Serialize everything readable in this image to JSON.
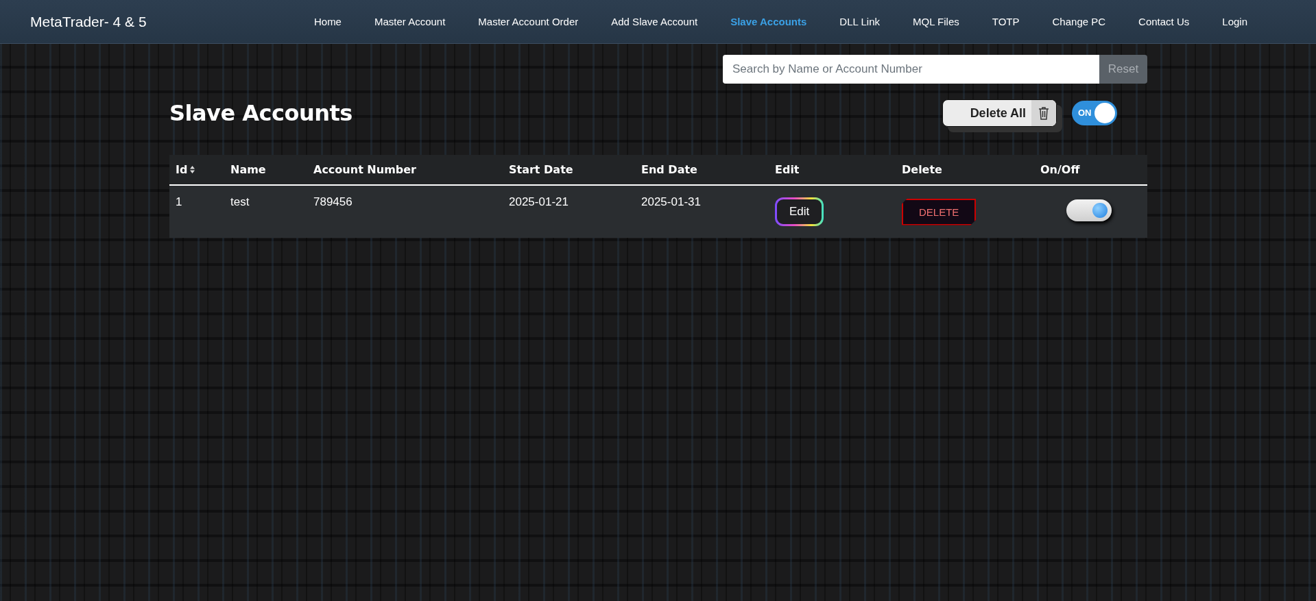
{
  "navbar": {
    "brand": "MetaTrader- 4 & 5",
    "items": [
      {
        "label": "Home",
        "selected": false
      },
      {
        "label": "Master Account",
        "selected": false
      },
      {
        "label": "Master Account Order",
        "selected": false
      },
      {
        "label": "Add Slave Account",
        "selected": false
      },
      {
        "label": "Slave Accounts",
        "selected": true
      },
      {
        "label": "DLL Link",
        "selected": false
      },
      {
        "label": "MQL Files",
        "selected": false
      },
      {
        "label": "TOTP",
        "selected": false
      },
      {
        "label": "Change PC",
        "selected": false
      },
      {
        "label": "Contact Us",
        "selected": false
      },
      {
        "label": "Login",
        "selected": false
      }
    ]
  },
  "search": {
    "placeholder": "Search by Name or Account Number",
    "reset": "Reset"
  },
  "title": "Slave Accounts",
  "delete_all": "Delete All",
  "master_toggle": {
    "label": "ON",
    "on": true
  },
  "table": {
    "columns": [
      "Id",
      "Name",
      "Account Number",
      "Start Date",
      "End Date",
      "Edit",
      "Delete",
      "On/Off"
    ],
    "rows": [
      {
        "id": "1",
        "name": "test",
        "account_number": "789456",
        "start_date": "2025-01-21",
        "end_date": "2025-01-31",
        "edit": "Edit",
        "delete": "DELETE",
        "on": true
      }
    ]
  }
}
